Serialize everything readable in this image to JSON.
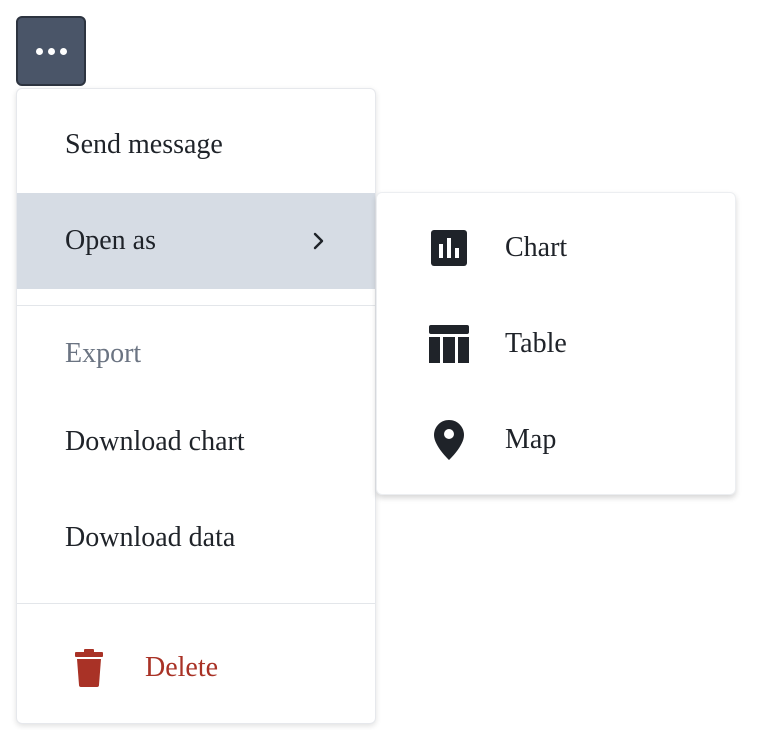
{
  "trigger": {
    "icon": "more-horizontal-icon"
  },
  "menu": {
    "items": [
      {
        "label": "Send message"
      },
      {
        "label": "Open as",
        "icon": "chevron-right-icon",
        "active": true
      }
    ],
    "export_group": {
      "label": "Export",
      "items": [
        {
          "label": "Download chart"
        },
        {
          "label": "Download data"
        }
      ]
    },
    "delete": {
      "label": "Delete",
      "icon": "trash-icon",
      "color": "#a93226"
    }
  },
  "submenu": {
    "items": [
      {
        "label": "Chart",
        "icon": "bar-chart-icon"
      },
      {
        "label": "Table",
        "icon": "table-icon"
      },
      {
        "label": "Map",
        "icon": "map-pin-icon"
      }
    ]
  },
  "colors": {
    "trigger_bg": "#4a5568",
    "active_item_bg": "#d6dce4",
    "text": "#1f2329",
    "muted_text": "#6b7482",
    "danger": "#a93226"
  }
}
